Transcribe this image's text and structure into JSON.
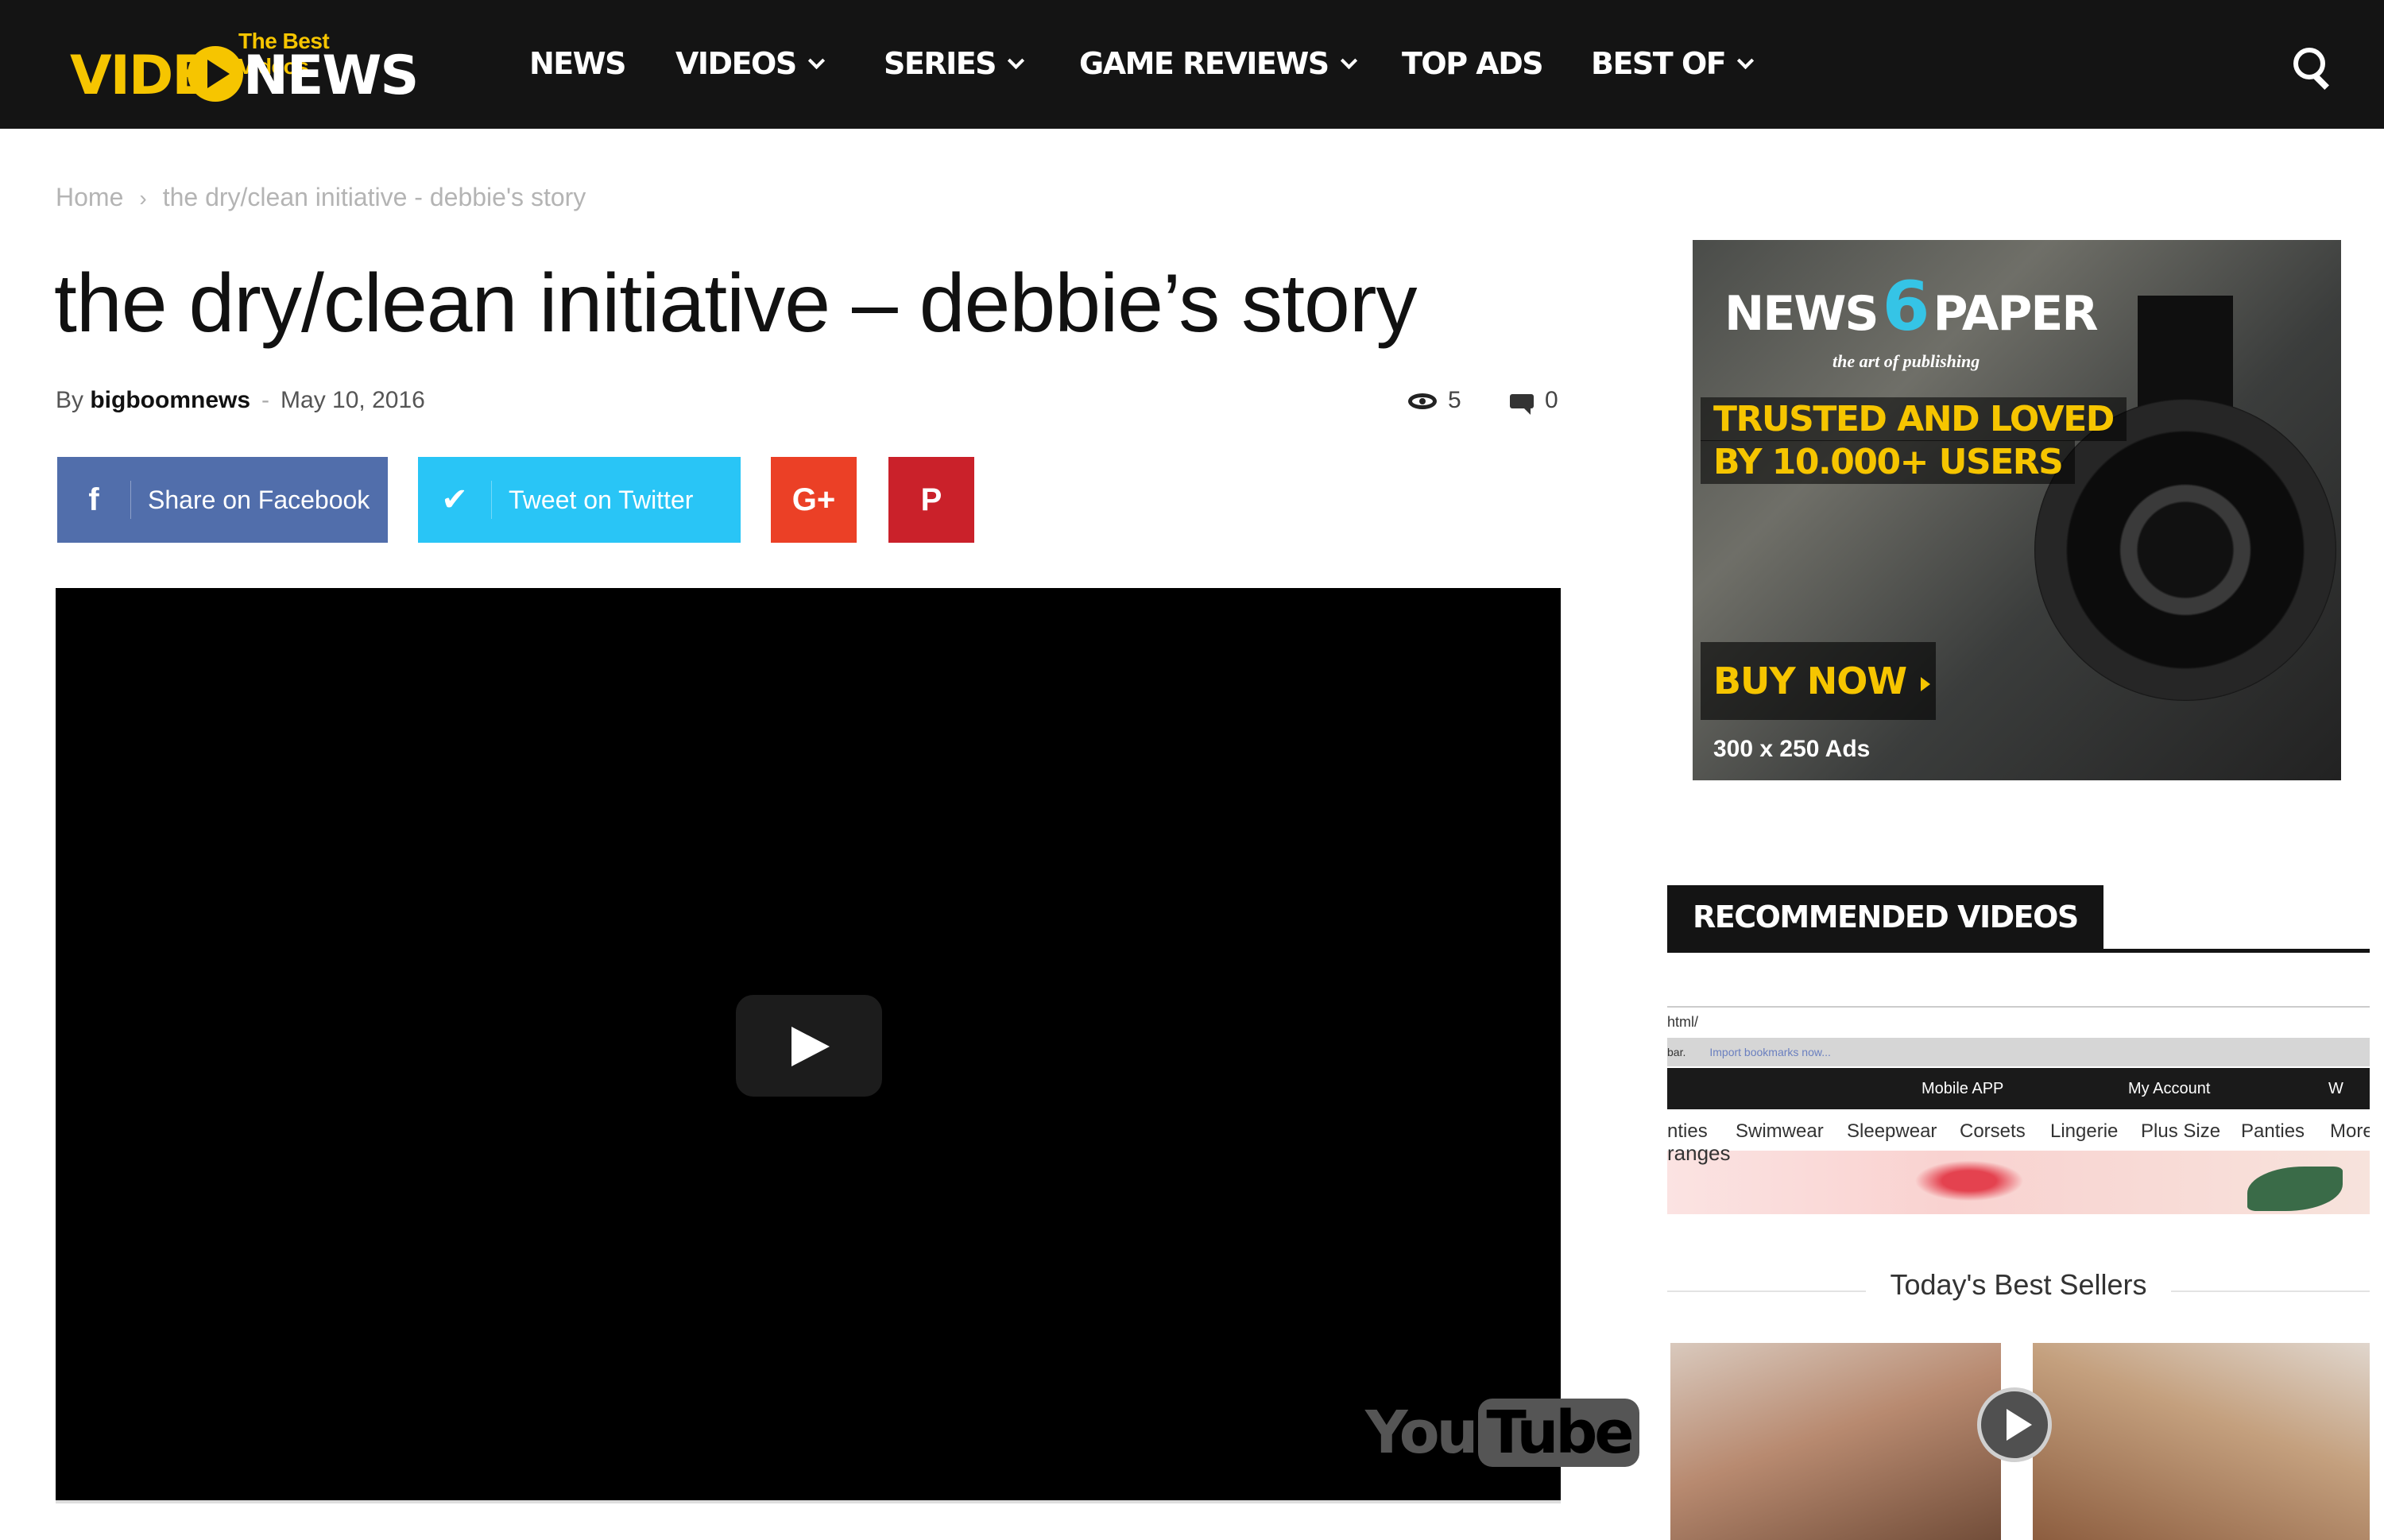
{
  "logo": {
    "tagline": "The Best Videos",
    "word_left": "VIDE",
    "word_right": "NEWS",
    "accent": "#f6c500"
  },
  "nav": {
    "items": [
      {
        "label": "NEWS",
        "has_dropdown": false
      },
      {
        "label": "VIDEOS",
        "has_dropdown": true
      },
      {
        "label": "SERIES",
        "has_dropdown": true
      },
      {
        "label": "GAME REVIEWS",
        "has_dropdown": true
      },
      {
        "label": "TOP ADS",
        "has_dropdown": false
      },
      {
        "label": "BEST OF",
        "has_dropdown": true
      }
    ],
    "search_icon": "search-icon"
  },
  "breadcrumb": {
    "home": "Home",
    "separator": "›",
    "current": "the dry/clean initiative - debbie's story"
  },
  "article": {
    "title": "the dry/clean initiative – debbie’s story",
    "by": "By",
    "author": "bigboomnews",
    "date_separator": "-",
    "date": "May 10, 2016",
    "views": "5",
    "comments": "0"
  },
  "share": {
    "facebook": {
      "icon": "f",
      "label": "Share on Facebook",
      "color": "#516eab"
    },
    "twitter": {
      "icon": "✔",
      "label": "Tweet on Twitter",
      "color": "#29c5f6"
    },
    "googleplus": {
      "icon": "G+",
      "color": "#eb4026"
    },
    "pinterest": {
      "icon": "P",
      "color": "#ca212a"
    }
  },
  "video": {
    "brand_you": "You",
    "brand_tube": "Tube"
  },
  "ad": {
    "brand_left": "NEWS",
    "brand_mark": "6",
    "brand_right": "PAPER",
    "brand_tagline": "the art of publishing",
    "line1": "TRUSTED AND LOVED",
    "line2": "BY 10.000+ USERS",
    "cta": "BUY NOW",
    "size_label": "300 x 250 Ads"
  },
  "recommended": {
    "title": "RECOMMENDED VIDEOS",
    "thumb": {
      "url": "html/",
      "bookmark_prefix": "bar.",
      "bookmark_link": "Import bookmarks now...",
      "mobile_app": "Mobile APP",
      "my_account": "My Account",
      "wishlist": "W",
      "categories": [
        "nties",
        "Swimwear",
        "Sleepwear",
        "Corsets",
        "Lingerie",
        "Plus Size",
        "Panties",
        "More"
      ],
      "banner_text": "ranges",
      "best_sellers": "Today's Best Sellers"
    }
  }
}
